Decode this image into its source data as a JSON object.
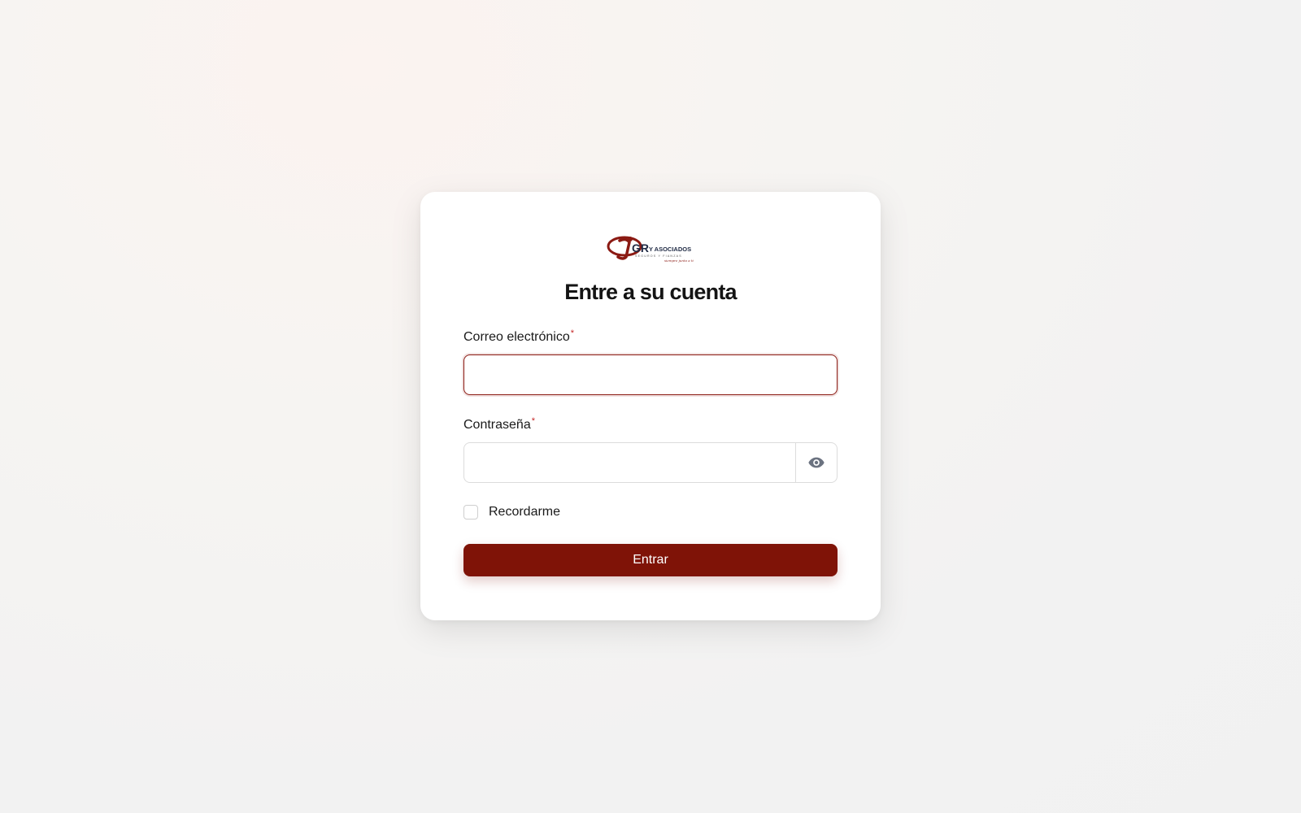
{
  "logo": {
    "brand_letters": "GR",
    "brand_text": "Y ASOCIADOS",
    "tagline": "SEGUROS Y FIANZAS",
    "slogan": "siempre junto a ti",
    "primary_color": "#8b1a13",
    "secondary_color": "#1f2a44"
  },
  "form": {
    "title": "Entre a su cuenta",
    "email": {
      "label": "Correo electrónico",
      "required_mark": "*",
      "value": ""
    },
    "password": {
      "label": "Contraseña",
      "required_mark": "*",
      "value": "",
      "toggle_icon": "eye-icon"
    },
    "remember": {
      "label": "Recordarme",
      "checked": false
    },
    "submit_label": "Entrar"
  },
  "colors": {
    "accent": "#7f1307",
    "required": "#c62828"
  }
}
